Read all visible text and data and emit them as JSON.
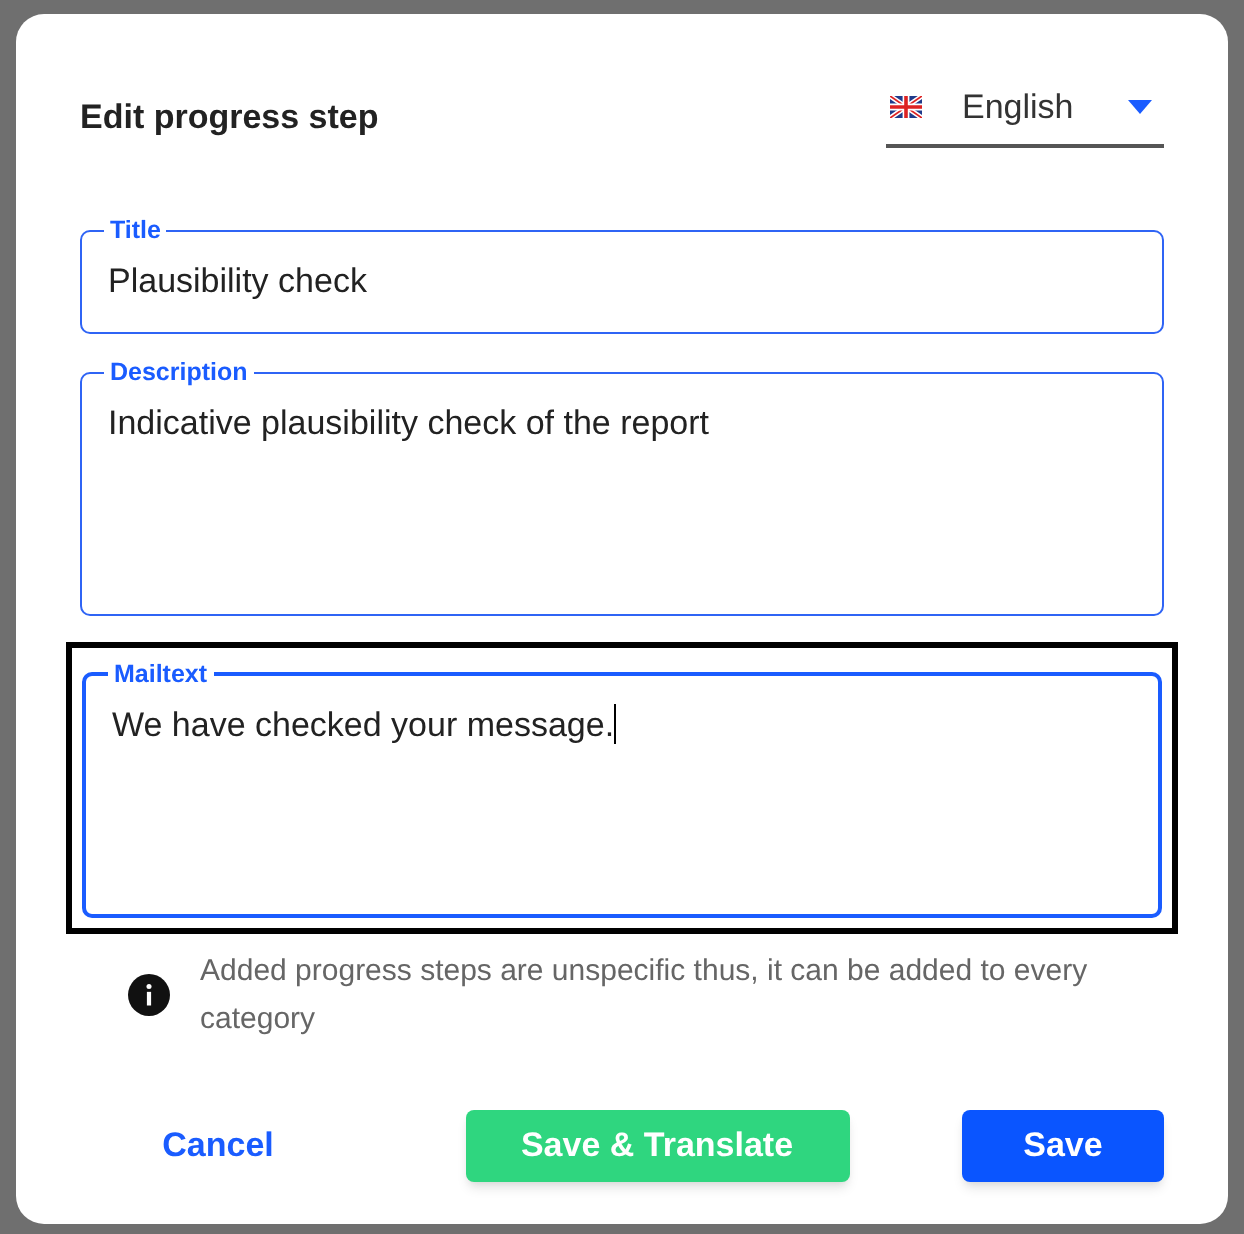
{
  "dialog": {
    "title": "Edit progress step",
    "language": {
      "value": "English"
    },
    "fields": [
      {
        "label": "Title",
        "value": "Plausibility check",
        "kind": "line",
        "focused": false
      },
      {
        "label": "Description",
        "value": "Indicative plausibility check of the report",
        "kind": "area",
        "focused": false
      },
      {
        "label": "Mailtext",
        "value": "We have checked your message.",
        "kind": "area",
        "focused": true
      }
    ],
    "info": "Added progress steps are unspecific thus, it can be added to every category",
    "buttons": [
      {
        "label": "Cancel",
        "kind": "text"
      },
      {
        "label": "Save & Translate",
        "kind": "green"
      },
      {
        "label": "Save",
        "kind": "primary"
      }
    ]
  }
}
